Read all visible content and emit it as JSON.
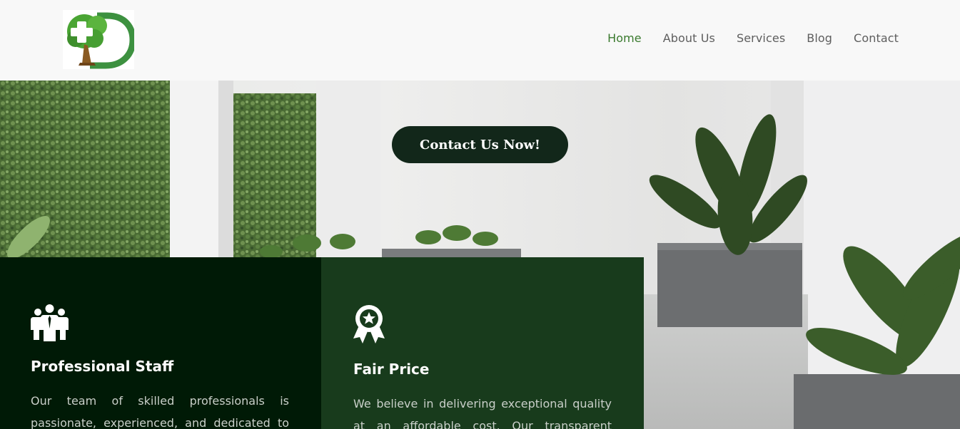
{
  "header": {
    "logo": {
      "icon": "tree-cross-d-logo",
      "colors": {
        "green": "#4c9a3a",
        "trunk": "#8a5a22"
      }
    },
    "nav": [
      {
        "label": "Home",
        "active": true
      },
      {
        "label": "About Us",
        "active": false
      },
      {
        "label": "Services",
        "active": false
      },
      {
        "label": "Blog",
        "active": false
      },
      {
        "label": "Contact",
        "active": false
      }
    ]
  },
  "hero": {
    "cta_label": "Contact Us Now!",
    "image": "plants-garden-photo"
  },
  "features": [
    {
      "icon": "team-people-icon",
      "title": "Professional Staff",
      "text_lines": [
        "Our team of skilled professionals is",
        "passionate, experienced, and dedicated to"
      ]
    },
    {
      "icon": "award-ribbon-icon",
      "title": "Fair Price",
      "text_lines": [
        "We believe in delivering exceptional quality",
        "at an affordable cost. Our transparent"
      ]
    }
  ],
  "colors": {
    "accent": "#3a7a2e",
    "nav_text": "#5e5e5e",
    "cta_bg": "#12271a",
    "card_dark": "#001a06",
    "card_green": "#183b1c"
  }
}
